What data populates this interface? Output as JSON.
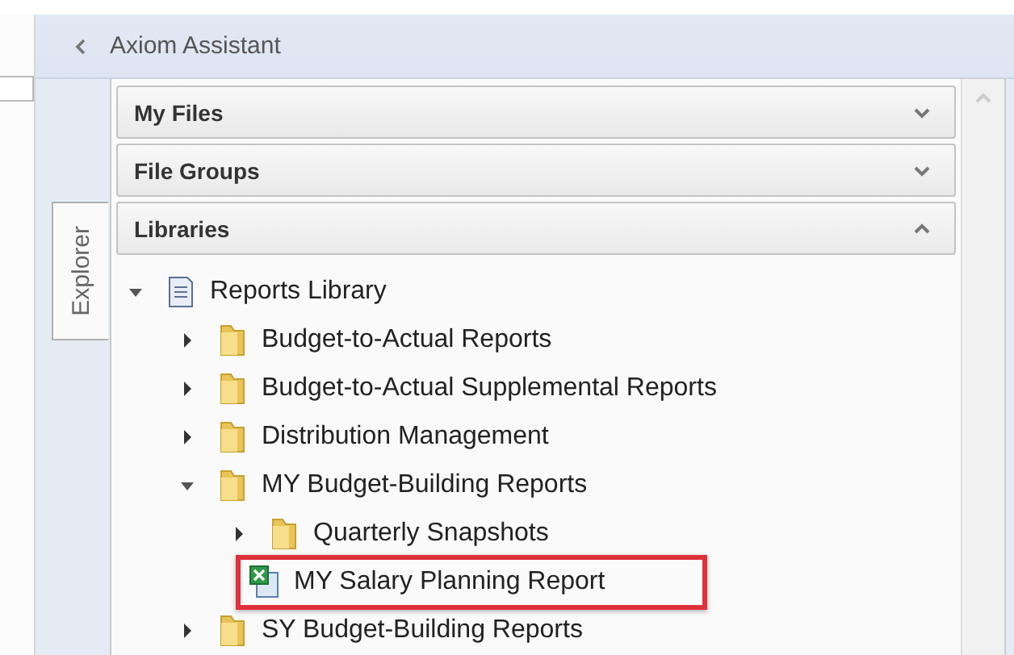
{
  "panel": {
    "title": "Axiom Assistant"
  },
  "side_tab": {
    "label": "Explorer",
    "selected": true
  },
  "sections": [
    {
      "label": "My Files",
      "expanded": false
    },
    {
      "label": "File Groups",
      "expanded": false
    },
    {
      "label": "Libraries",
      "expanded": true
    }
  ],
  "tree": [
    {
      "label": "Reports Library",
      "kind": "library",
      "expanded": true,
      "children": [
        {
          "label": "Budget-to-Actual Reports",
          "kind": "folder",
          "expanded": false
        },
        {
          "label": "Budget-to-Actual Supplemental Reports",
          "kind": "folder",
          "expanded": false
        },
        {
          "label": "Distribution Management",
          "kind": "folder",
          "expanded": false
        },
        {
          "label": "MY Budget-Building Reports",
          "kind": "folder",
          "expanded": true,
          "children": [
            {
              "label": "Quarterly Snapshots",
              "kind": "folder",
              "expanded": false
            },
            {
              "label": "MY Salary Planning Report",
              "kind": "report",
              "highlighted": true
            }
          ]
        },
        {
          "label": "SY Budget-Building Reports",
          "kind": "folder",
          "expanded": false
        }
      ]
    }
  ]
}
